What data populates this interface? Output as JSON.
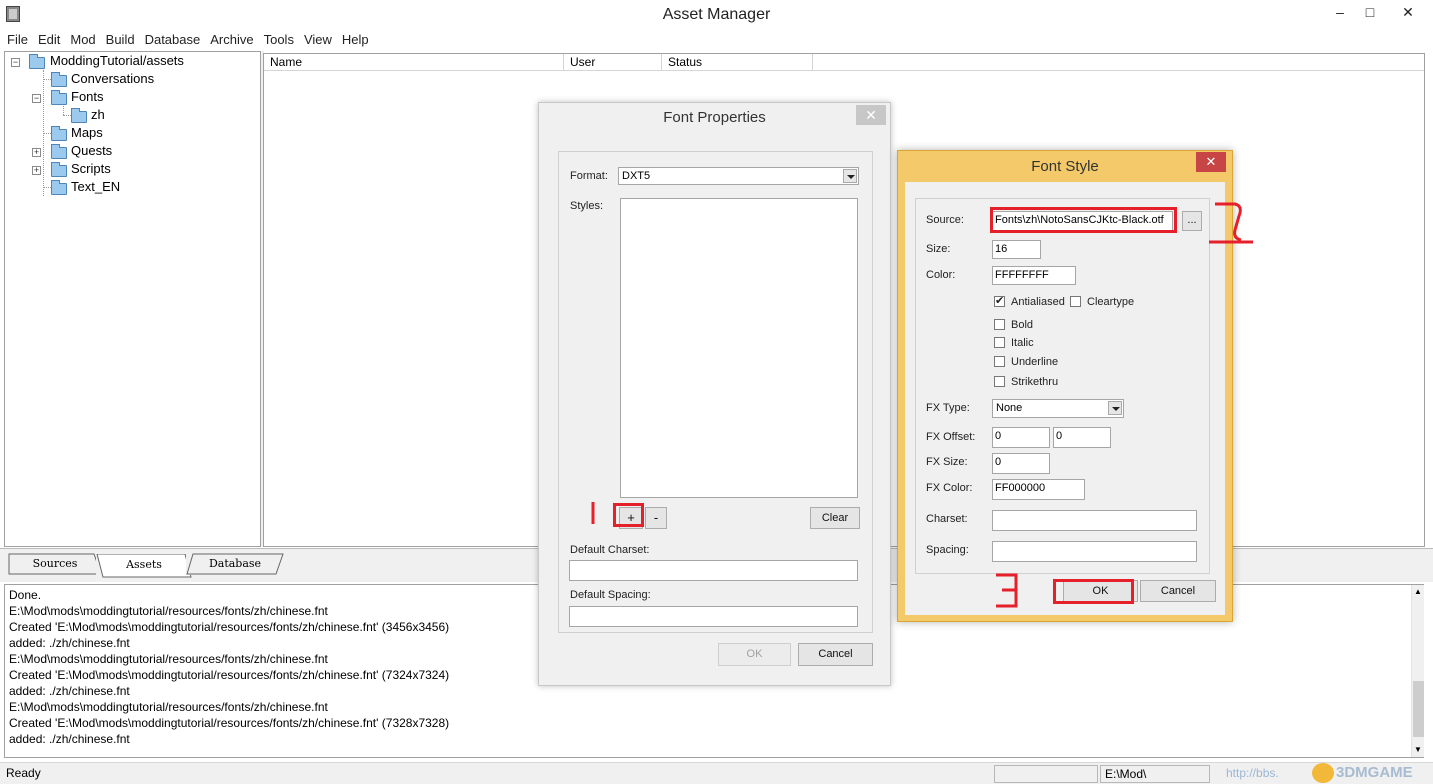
{
  "window": {
    "title": "Asset Manager",
    "controls": {
      "minimize": "–",
      "maximize": "□",
      "close": "✕"
    }
  },
  "menu": [
    "File",
    "Edit",
    "Mod",
    "Build",
    "Database",
    "Archive",
    "Tools",
    "View",
    "Help"
  ],
  "tree": {
    "root": "ModdingTutorial/assets",
    "items": [
      "Conversations",
      "Fonts",
      "zh",
      "Maps",
      "Quests",
      "Scripts",
      "Text_EN"
    ],
    "expanders": {
      "root": "−",
      "fonts": "−",
      "quests": "+",
      "scripts": "+"
    }
  },
  "list": {
    "columns": [
      "Name",
      "User",
      "Status"
    ]
  },
  "tabs": [
    "Sources",
    "Assets",
    "Database"
  ],
  "log": [
    "Done.",
    "E:\\Mod\\mods\\moddingtutorial/resources/fonts/zh/chinese.fnt",
    "Created 'E:\\Mod\\mods\\moddingtutorial/resources/fonts/zh/chinese.fnt' (3456x3456)",
    "added: ./zh/chinese.fnt",
    "E:\\Mod\\mods\\moddingtutorial/resources/fonts/zh/chinese.fnt",
    "Created 'E:\\Mod\\mods\\moddingtutorial/resources/fonts/zh/chinese.fnt' (7324x7324)",
    "added: ./zh/chinese.fnt",
    "E:\\Mod\\mods\\moddingtutorial/resources/fonts/zh/chinese.fnt",
    "Created 'E:\\Mod\\mods\\moddingtutorial/resources/fonts/zh/chinese.fnt' (7328x7328)",
    "added: ./zh/chinese.fnt"
  ],
  "status": {
    "text": "Ready",
    "path": "E:\\Mod\\",
    "watermark": "http://bbs.",
    "watermark_brand": "3DMGAME"
  },
  "font_properties": {
    "title": "Font Properties",
    "close": "✕",
    "format_label": "Format:",
    "format_value": "DXT5",
    "styles_label": "Styles:",
    "add": "+",
    "remove": "-",
    "clear": "Clear",
    "charset_label": "Default Charset:",
    "charset_value": "",
    "spacing_label": "Default Spacing:",
    "spacing_value": "",
    "ok": "OK",
    "cancel": "Cancel"
  },
  "font_style": {
    "title": "Font Style",
    "close": "✕",
    "source_label": "Source:",
    "source_value": "Fonts\\zh\\NotoSansCJKtc-Black.otf",
    "browse": "...",
    "size_label": "Size:",
    "size_value": "16",
    "color_label": "Color:",
    "color_value": "FFFFFFFF",
    "checks": {
      "antialiased": {
        "label": "Antialiased",
        "checked": true
      },
      "cleartype": {
        "label": "Cleartype",
        "checked": false
      },
      "bold": {
        "label": "Bold",
        "checked": false
      },
      "italic": {
        "label": "Italic",
        "checked": false
      },
      "underline": {
        "label": "Underline",
        "checked": false
      },
      "strikethru": {
        "label": "Strikethru",
        "checked": false
      }
    },
    "fx_type_label": "FX Type:",
    "fx_type_value": "None",
    "fx_offset_label": "FX Offset:",
    "fx_offset_x": "0",
    "fx_offset_y": "0",
    "fx_size_label": "FX Size:",
    "fx_size_value": "0",
    "fx_color_label": "FX Color:",
    "fx_color_value": "FF000000",
    "charset_label": "Charset:",
    "charset_value": "",
    "spacing_label": "Spacing:",
    "spacing_value": "",
    "ok": "OK",
    "cancel": "Cancel"
  },
  "colors": {
    "annotation_red": "#e5202a",
    "font_style_frame": "#f3c96a",
    "font_style_close": "#c74545",
    "folder_fill": "#9cc9ee"
  }
}
